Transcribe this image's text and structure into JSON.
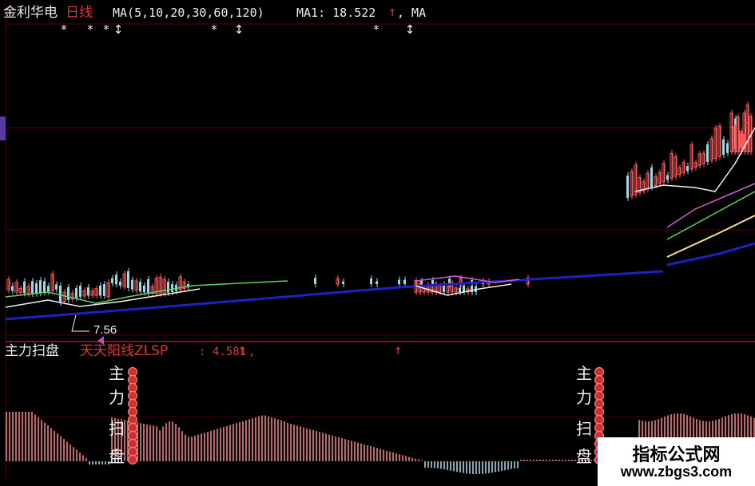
{
  "header": {
    "stock_name": "金利华电",
    "period": "日线",
    "ma_params": "MA(5,10,20,30,60,120)",
    "ma1_label": "MA1: 18.522",
    "ma1_arrow": "↑",
    "ma_suffix": ", MA"
  },
  "main_chart": {
    "low_price_label": "7.56",
    "colors": {
      "up": "#ff5a5a",
      "down": "#9ad8e8",
      "ma1": "#f0f0f0",
      "ma2": "#f3e08c",
      "ma3": "#d060d0",
      "ma4": "#60d060",
      "ma5": "#2020c0",
      "grid": "#5a0000"
    },
    "markers": [
      "*",
      "*",
      "*",
      "↕",
      "*",
      "↕",
      "*",
      "↕"
    ]
  },
  "indicator": {
    "title": "主力扫盘",
    "name": "天天阳线ZLSP",
    "value": ": 4.581",
    "arrow": "↑",
    "comma": ",",
    "arrow2": "↑",
    "signal_chars": [
      "主",
      "力",
      "扫",
      "盘"
    ],
    "colors": {
      "positive": "#f08080",
      "negative": "#9ad8e8",
      "signal_dot": "#d03030"
    }
  },
  "watermark": {
    "name": "指标公式网",
    "url": "www.zbgs3.com"
  }
}
